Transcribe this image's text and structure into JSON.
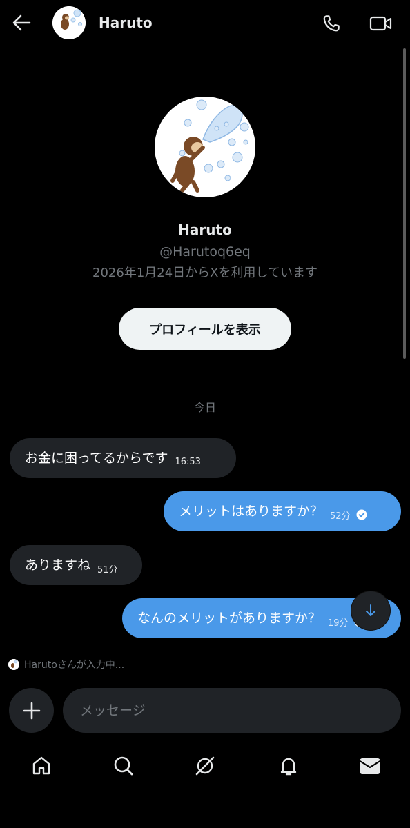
{
  "header": {
    "name": "Haruto"
  },
  "profile": {
    "name": "Haruto",
    "handle": "@Harutoq6eq",
    "joined": "2026年1月24日からXを利用しています",
    "view_profile_label": "プロフィールを表示"
  },
  "date_separator": "今日",
  "messages": [
    {
      "direction": "incoming",
      "text": "お金に困ってるからです",
      "time": "16:53"
    },
    {
      "direction": "outgoing",
      "text": "メリットはありますか？",
      "time": "52分",
      "read": true
    },
    {
      "direction": "incoming",
      "text": "ありますね",
      "time": "51分"
    },
    {
      "direction": "outgoing",
      "text": "なんのメリットがありますか？",
      "time": "19分",
      "read": true
    }
  ],
  "typing_indicator": "Harutoさんが入力中...",
  "composer": {
    "placeholder": "メッセージ"
  },
  "colors": {
    "background": "#000000",
    "incoming_bubble": "#202327",
    "outgoing_bubble": "#4a99e9",
    "secondary_text": "#71767b",
    "primary_text": "#e7e9ea"
  },
  "icons": {
    "back": "arrow-left-icon",
    "call": "phone-icon",
    "video": "video-camera-icon",
    "scroll_down": "arrow-down-icon",
    "add": "plus-icon",
    "read_receipt": "check-circle-icon",
    "nav": [
      "home-icon",
      "search-icon",
      "grok-icon",
      "bell-icon",
      "mail-icon"
    ]
  },
  "nav": {
    "active": "messages"
  }
}
